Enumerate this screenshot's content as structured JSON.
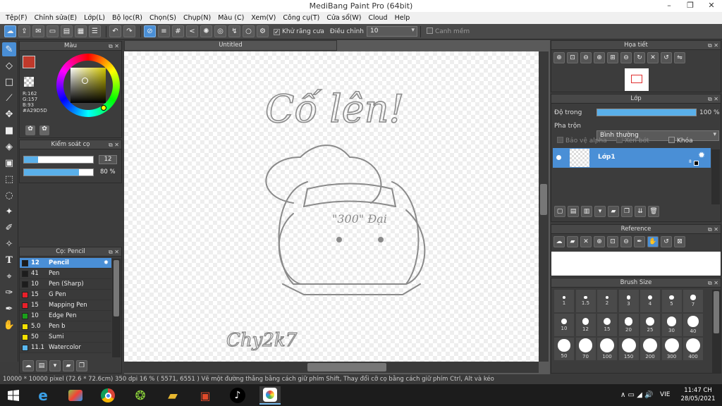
{
  "window": {
    "title": "MediBang Paint Pro (64bit)",
    "minimize": "–",
    "maximize": "❐",
    "close": "✕"
  },
  "menu": [
    "Tệp(F)",
    "Chỉnh sửa(E)",
    "Lớp(L)",
    "Bộ lọc(R)",
    "Chọn(S)",
    "Chụp(N)",
    "Màu (C)",
    "Xem(V)",
    "Công cụ(T)",
    "Cửa sổ(W)",
    "Cloud",
    "Help"
  ],
  "toolbar": {
    "antialias_label": "Khử răng cưa",
    "antialias_checked": true,
    "adjust_label": "Điều chỉnh",
    "adjust_value": "10",
    "smooth_label": "Canh mềm",
    "smooth_checked": false
  },
  "color_panel": {
    "title": "Màu",
    "r": "R:162",
    "g": "G:157",
    "b": "B:93",
    "hex": "#A29D5D",
    "primary_color": "#c0392b",
    "secondary_color": "#ffffff"
  },
  "brush_control": {
    "title": "Kiểm soát cọ",
    "size": "12",
    "opacity": "80 %",
    "size_fraction": 0.2,
    "opacity_fraction": 0.8
  },
  "brush_panel": {
    "title": "Cọ: Pencil",
    "items": [
      {
        "size": "12",
        "name": "Pencil",
        "color": "#1c1c1c",
        "selected": true
      },
      {
        "size": "41",
        "name": "Pen",
        "color": "#1c1c1c"
      },
      {
        "size": "10",
        "name": "Pen (Sharp)",
        "color": "#1c1c1c"
      },
      {
        "size": "15",
        "name": "G Pen",
        "color": "#e8202a"
      },
      {
        "size": "15",
        "name": "Mapping Pen",
        "color": "#e8202a"
      },
      {
        "size": "10",
        "name": "Edge Pen",
        "color": "#1a9e1a"
      },
      {
        "size": "5.0",
        "name": "Pen b",
        "color": "#f4e000"
      },
      {
        "size": "50",
        "name": "Sumi",
        "color": "#f4e000"
      },
      {
        "size": "11.1",
        "name": "Watercolor",
        "color": "#5ab8f0"
      }
    ]
  },
  "document": {
    "tab": "Untitled"
  },
  "navigator": {
    "title": "Họa tiết"
  },
  "layer_panel": {
    "title": "Lớp",
    "opacity_label": "Độ trong",
    "opacity_value": "100 %",
    "opacity_fraction": 1.0,
    "blend_label": "Pha trộn",
    "blend_value": "Bình thường",
    "protect_alpha": "Bảo vệ alpha",
    "clipping": "Xén bớt",
    "lock": "Khóa",
    "layers": [
      {
        "name": "Lớp1",
        "badge": "8"
      }
    ]
  },
  "reference_panel": {
    "title": "Reference"
  },
  "brush_size_panel": {
    "title": "Brush Size",
    "sizes": [
      "1",
      "1.5",
      "2",
      "3",
      "4",
      "5",
      "7",
      "10",
      "12",
      "15",
      "20",
      "25",
      "30",
      "40",
      "50",
      "70",
      "100",
      "150",
      "200",
      "300",
      "400"
    ]
  },
  "status": "10000 * 10000 pixel   (72.6 * 72.6cm)   350 dpi   16 %   ( 5571, 6551 )   Vẽ một đường thẳng bằng cách giữ phím Shift, Thay đổi cỡ cọ bằng cách giữ phím Ctrl, Alt và kéo",
  "taskbar": {
    "lang": "VIE",
    "time": "11:47 CH",
    "date": "28/05/2021"
  },
  "drawing": {
    "text1": "Cố lên!",
    "text2": "\"300\" Đại",
    "signature": "Chy2k7"
  }
}
